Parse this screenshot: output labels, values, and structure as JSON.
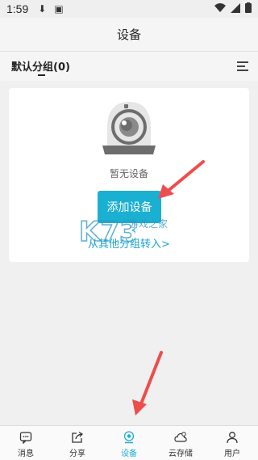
{
  "status_bar": {
    "time": "1:59"
  },
  "header": {
    "title": "设备"
  },
  "group": {
    "label": "默认分组(0)"
  },
  "empty_state": {
    "message": "暂无设备",
    "add_button_label": "添加设备",
    "transfer_link_label": "从其他分组转入>"
  },
  "watermark": {
    "text": "游戏之家"
  },
  "tabs": [
    {
      "label": "消息",
      "icon": "message-icon"
    },
    {
      "label": "分享",
      "icon": "share-icon"
    },
    {
      "label": "设备",
      "icon": "device-icon",
      "active": true
    },
    {
      "label": "云存储",
      "icon": "cloud-storage-icon"
    },
    {
      "label": "用户",
      "icon": "user-icon"
    }
  ],
  "colors": {
    "accent": "#1ab0d2",
    "link": "#1aa5d0",
    "arrow": "#ee4d4d"
  }
}
